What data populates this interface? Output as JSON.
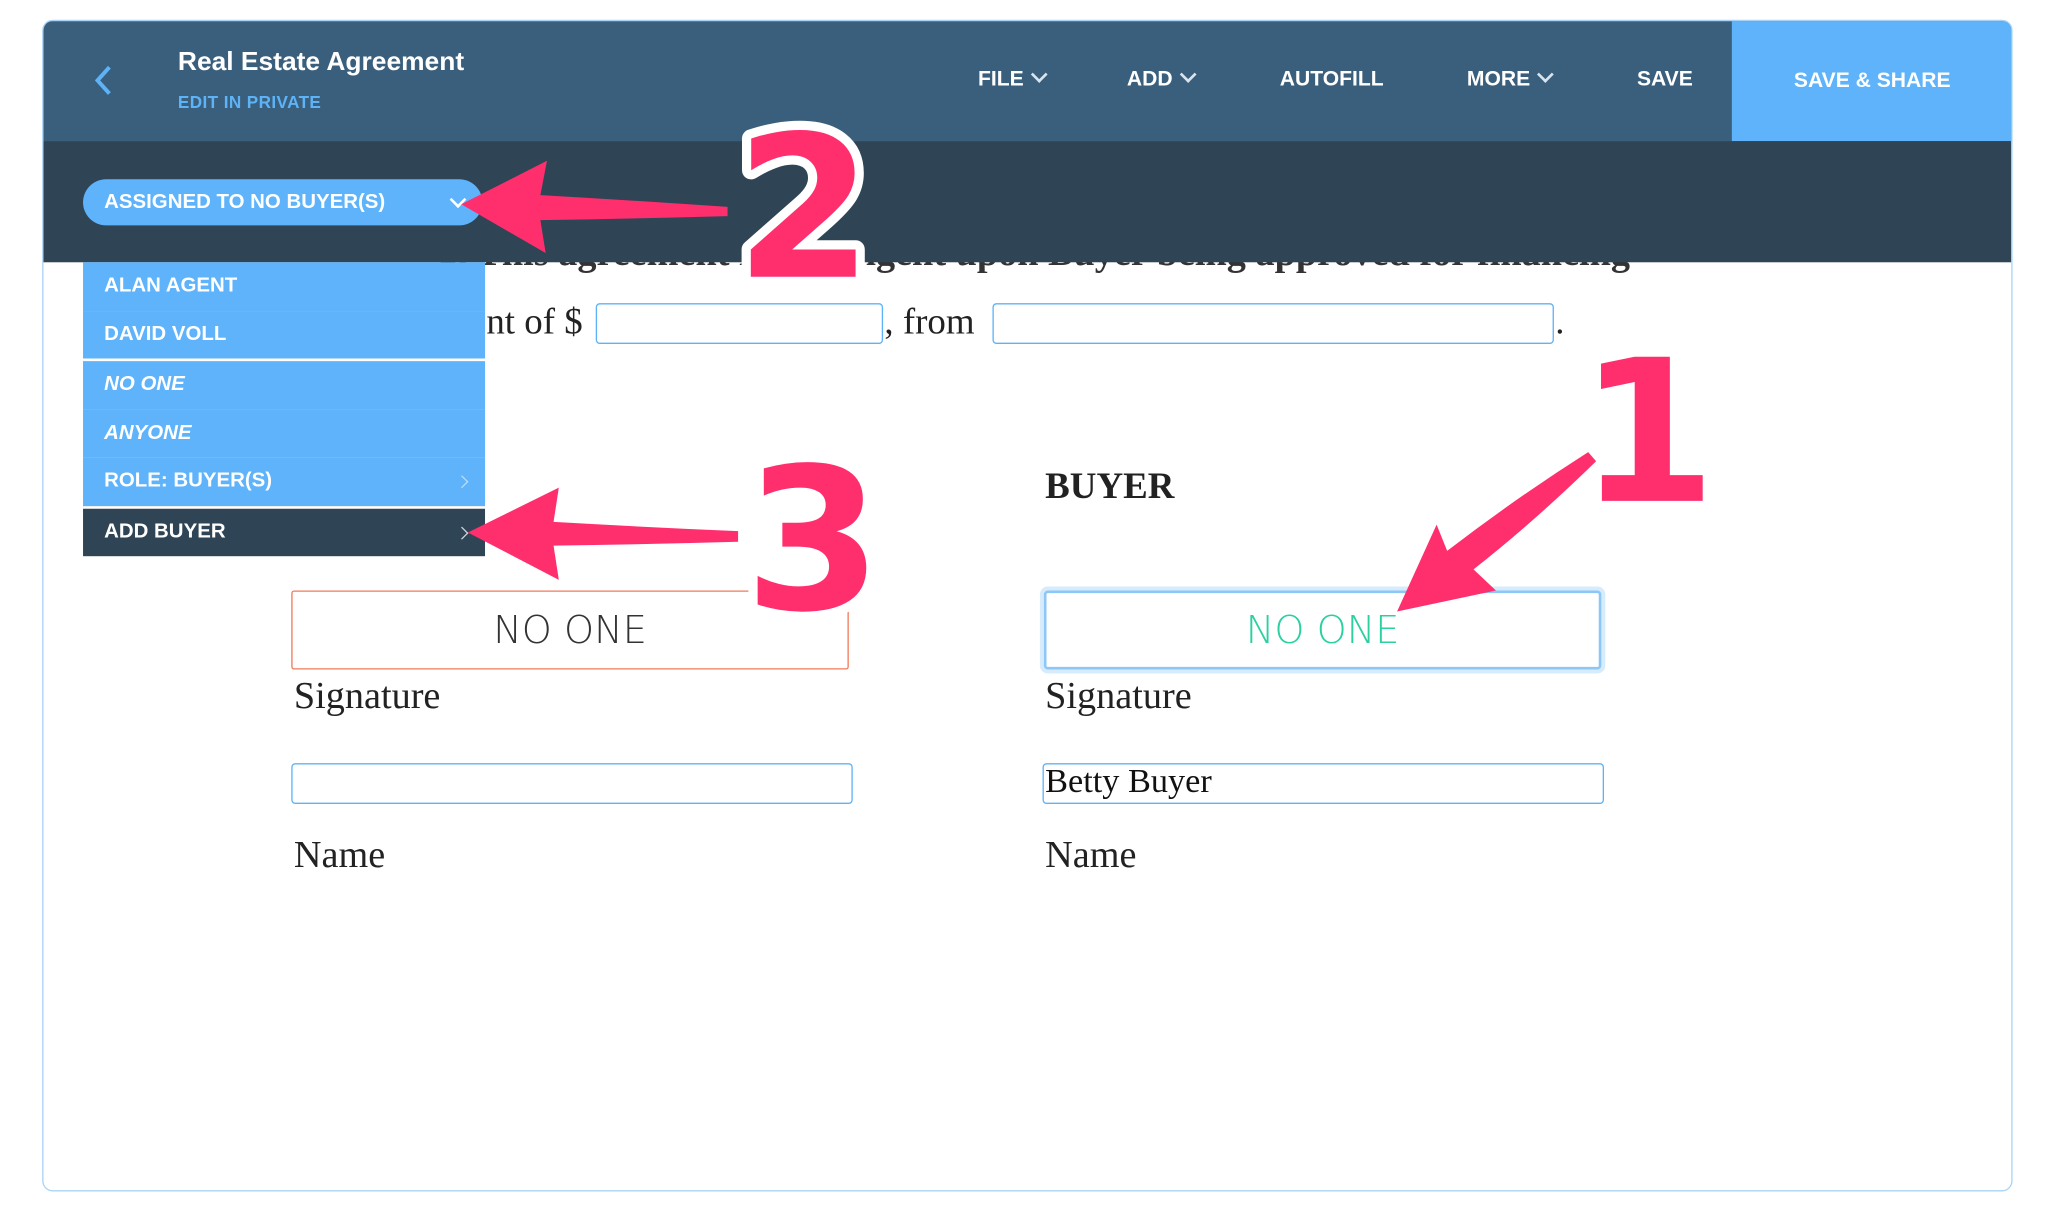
{
  "header": {
    "back_icon": "chevron-left-icon",
    "title": "Real Estate Agreement",
    "subtitle": "EDIT IN PRIVATE",
    "nav": [
      {
        "label": "FILE",
        "dropdown": true
      },
      {
        "label": "ADD",
        "dropdown": true
      },
      {
        "label": "AUTOFILL",
        "dropdown": false
      },
      {
        "label": "MORE",
        "dropdown": true
      },
      {
        "label": "SAVE",
        "dropdown": false
      }
    ],
    "save_share": "SAVE & SHARE"
  },
  "toolbar": {
    "assign_pill": "ASSIGNED TO NO BUYER(S)"
  },
  "menu": {
    "items": [
      {
        "label": "ALAN AGENT"
      },
      {
        "label": "DAVID VOLL"
      },
      {
        "label": "NO ONE"
      },
      {
        "label": "ANYONE"
      },
      {
        "label": "ROLE: BUYER(S)"
      },
      {
        "label": "ADD BUYER"
      }
    ]
  },
  "document": {
    "line1": "g. This agreement is contingent upon Buyer being approved for financing",
    "line2_a": "nt of $",
    "line2_b": ", from",
    "line2_c": ".",
    "amount_value": "",
    "from_value": "",
    "buyer_heading": "BUYER",
    "left": {
      "signature_value": "NO ONE",
      "signature_label": "Signature",
      "name_value": "",
      "name_label": "Name"
    },
    "right": {
      "signature_value": "NO ONE",
      "signature_label": "Signature",
      "name_value": "Betty Buyer",
      "name_label": "Name"
    }
  },
  "annotations": {
    "step1": "1",
    "step2": "2",
    "step3": "3"
  },
  "colors": {
    "header": "#3a5f7d",
    "toolbar": "#2f4556",
    "accent": "#5eb3fb",
    "annotation": "#ff2f6e",
    "unassigned_border": "#f07a5a",
    "assigned_text": "#2ad0a0"
  }
}
